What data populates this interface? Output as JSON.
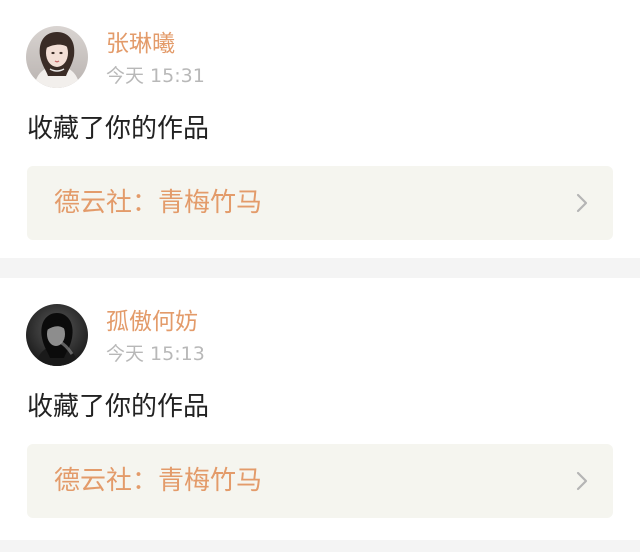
{
  "notifications": [
    {
      "username": "张琳曦",
      "time": "今天 15:31",
      "action": "收藏了你的作品",
      "work_title": "德云社：青梅竹马",
      "avatar_icon": "user-avatar-photo"
    },
    {
      "username": "孤傲何妨",
      "time": "今天 15:13",
      "action": "收藏了你的作品",
      "work_title": "德云社：青梅竹马",
      "avatar_icon": "user-avatar-photo-dark"
    }
  ],
  "colors": {
    "accent": "#e39b6a",
    "muted": "#b8b8b8",
    "text": "#222222",
    "link_bg": "#f5f5ef",
    "page_bg": "#f4f4f4"
  }
}
